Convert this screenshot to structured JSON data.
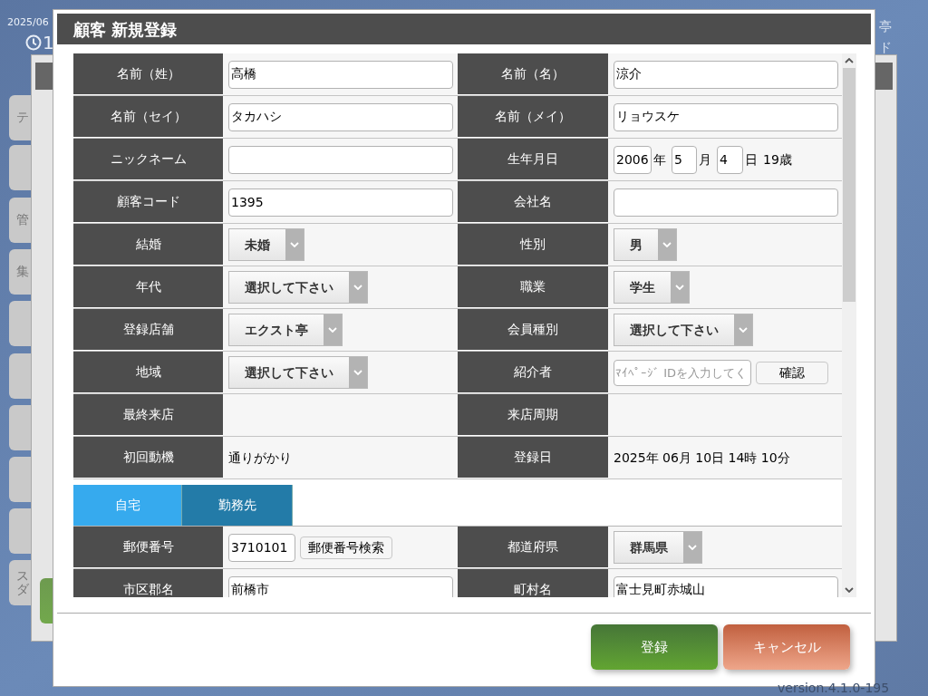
{
  "background": {
    "date": "2025/06",
    "time": "1",
    "header_fragments": [
      "亭",
      "ド"
    ],
    "side_buttons": [
      {
        "kind": "label",
        "label": "テ"
      },
      {
        "kind": "blank"
      },
      {
        "kind": "label",
        "label": "管"
      },
      {
        "kind": "label",
        "label": "集"
      },
      {
        "kind": "blank"
      },
      {
        "kind": "blank"
      },
      {
        "kind": "blank"
      },
      {
        "kind": "blank"
      },
      {
        "kind": "blank"
      },
      {
        "kind": "label",
        "label": "スダ"
      }
    ],
    "version": "version.4.1.0-195"
  },
  "dialog": {
    "title": "顧客 新規登録",
    "rows": [
      [
        {
          "label": "名前（姓）",
          "kind": "input",
          "value": "高橋"
        },
        {
          "label": "名前（名）",
          "kind": "input",
          "value": "涼介"
        }
      ],
      [
        {
          "label": "名前（セイ）",
          "kind": "input",
          "value": "タカハシ"
        },
        {
          "label": "名前（メイ）",
          "kind": "input",
          "value": "リョウスケ"
        }
      ],
      [
        {
          "label": "ニックネーム",
          "kind": "input"
        },
        {
          "label": "生年月日",
          "kind": "birthdate",
          "year": "2006",
          "year_unit": "年",
          "month": "5",
          "month_unit": "月",
          "day": "4",
          "day_unit": "日",
          "age": "19歳"
        }
      ],
      [
        {
          "label": "顧客コード",
          "kind": "input",
          "value": "1395"
        },
        {
          "label": "会社名",
          "kind": "input"
        }
      ],
      [
        {
          "label": "結婚",
          "kind": "select",
          "value": "未婚"
        },
        {
          "label": "性別",
          "kind": "select",
          "value": "男"
        }
      ],
      [
        {
          "label": "年代",
          "kind": "select",
          "value": "選択して下さい"
        },
        {
          "label": "職業",
          "kind": "select",
          "value": "学生"
        }
      ],
      [
        {
          "label": "登録店舗",
          "kind": "select",
          "value": "エクスト亭"
        },
        {
          "label": "会員種別",
          "kind": "select",
          "value": "選択して下さい"
        }
      ],
      [
        {
          "label": "地域",
          "kind": "select",
          "value": "選択して下さい"
        },
        {
          "label": "紹介者",
          "kind": "lookup",
          "placeholder": "ﾏｲﾍﾟｰｼﾞ IDを入力してく",
          "button": "確認"
        }
      ],
      [
        {
          "label": "最終来店",
          "kind": "text"
        },
        {
          "label": "来店周期",
          "kind": "text"
        }
      ],
      [
        {
          "label": "初回動機",
          "kind": "text",
          "value": "通りがかり"
        },
        {
          "label": "登録日",
          "kind": "text",
          "value": "2025年 06月 10日 14時 10分"
        }
      ]
    ],
    "tabs": [
      {
        "label": "自宅",
        "selected": true
      },
      {
        "label": "勤務先",
        "selected": false
      }
    ],
    "address_rows": [
      [
        {
          "label": "郵便番号",
          "kind": "zip",
          "value": "3710101",
          "button": "郵便番号検索"
        },
        {
          "label": "都道府県",
          "kind": "select",
          "value": "群馬県"
        }
      ],
      [
        {
          "label": "市区郡名",
          "kind": "input",
          "value": "前橋市"
        },
        {
          "label": "町村名",
          "kind": "input",
          "value": "富士見町赤城山"
        }
      ]
    ],
    "buttons": [
      {
        "label": "登録",
        "kind": "primary"
      },
      {
        "label": "キャンセル",
        "kind": "cancel"
      }
    ]
  }
}
